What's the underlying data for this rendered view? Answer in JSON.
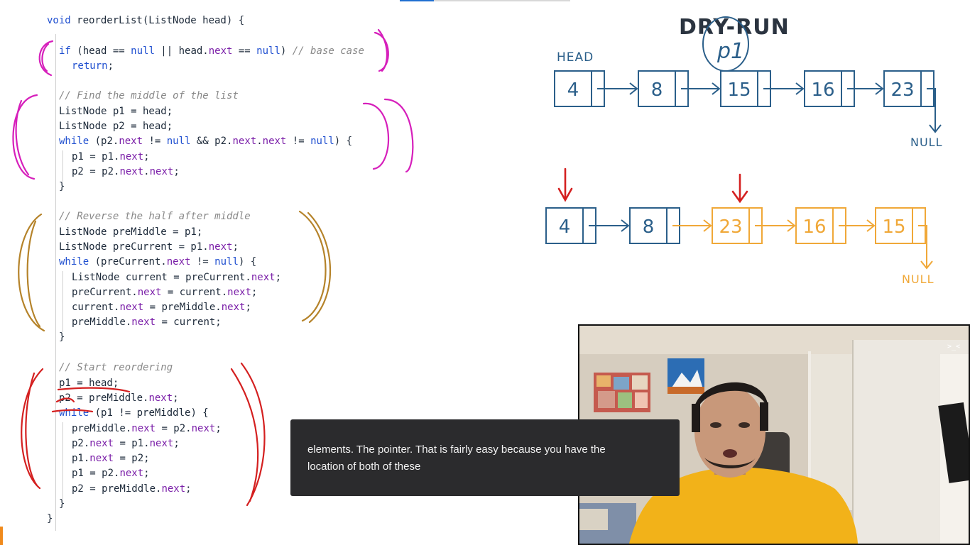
{
  "video": {
    "progress_fraction": 0.2
  },
  "code": {
    "lines": [
      "void reorderList(ListNode head) {",
      "if (head == null || head.next == null) // base case",
      "return;",
      "// Find the middle of the list",
      "ListNode p1 = head;",
      "ListNode p2 = head;",
      "while (p2.next != null && p2.next.next != null) {",
      "p1 = p1.next;",
      "p2 = p2.next.next;",
      "}",
      "// Reverse the half after middle",
      "ListNode preMiddle = p1;",
      "ListNode preCurrent = p1.next;",
      "while (preCurrent.next != null) {",
      "ListNode current = preCurrent.next;",
      "preCurrent.next = current.next;",
      "current.next = preMiddle.next;",
      "preMiddle.next = current;",
      "}",
      "// Start reordering",
      "p1 = head;",
      "p2 = preMiddle.next;",
      "while (p1 != preMiddle) {",
      "preMiddle.next = p2.next;",
      "p2.next = p1.next;",
      "p1.next = p2;",
      "p1 = p2.next;",
      "p2 = preMiddle.next;",
      "}",
      "}"
    ]
  },
  "diagram": {
    "title": "DRY-RUN",
    "annotation_p1": "p1",
    "head_label": "HEAD",
    "null_label": "NULL",
    "list_original": [
      "4",
      "8",
      "15",
      "16",
      "23"
    ],
    "list_reordered": [
      "4",
      "8",
      "23",
      "16",
      "15"
    ],
    "colors": {
      "ink": "#2b5f8a",
      "orange": "#f0a838",
      "red": "#d42020",
      "pink": "#d61fbb",
      "brown": "#b5832a"
    }
  },
  "caption": {
    "line1": "elements. The pointer. That is fairly easy because you have the",
    "line2": "location of both of these"
  },
  "webcam": {
    "menu_label": ">_<"
  }
}
